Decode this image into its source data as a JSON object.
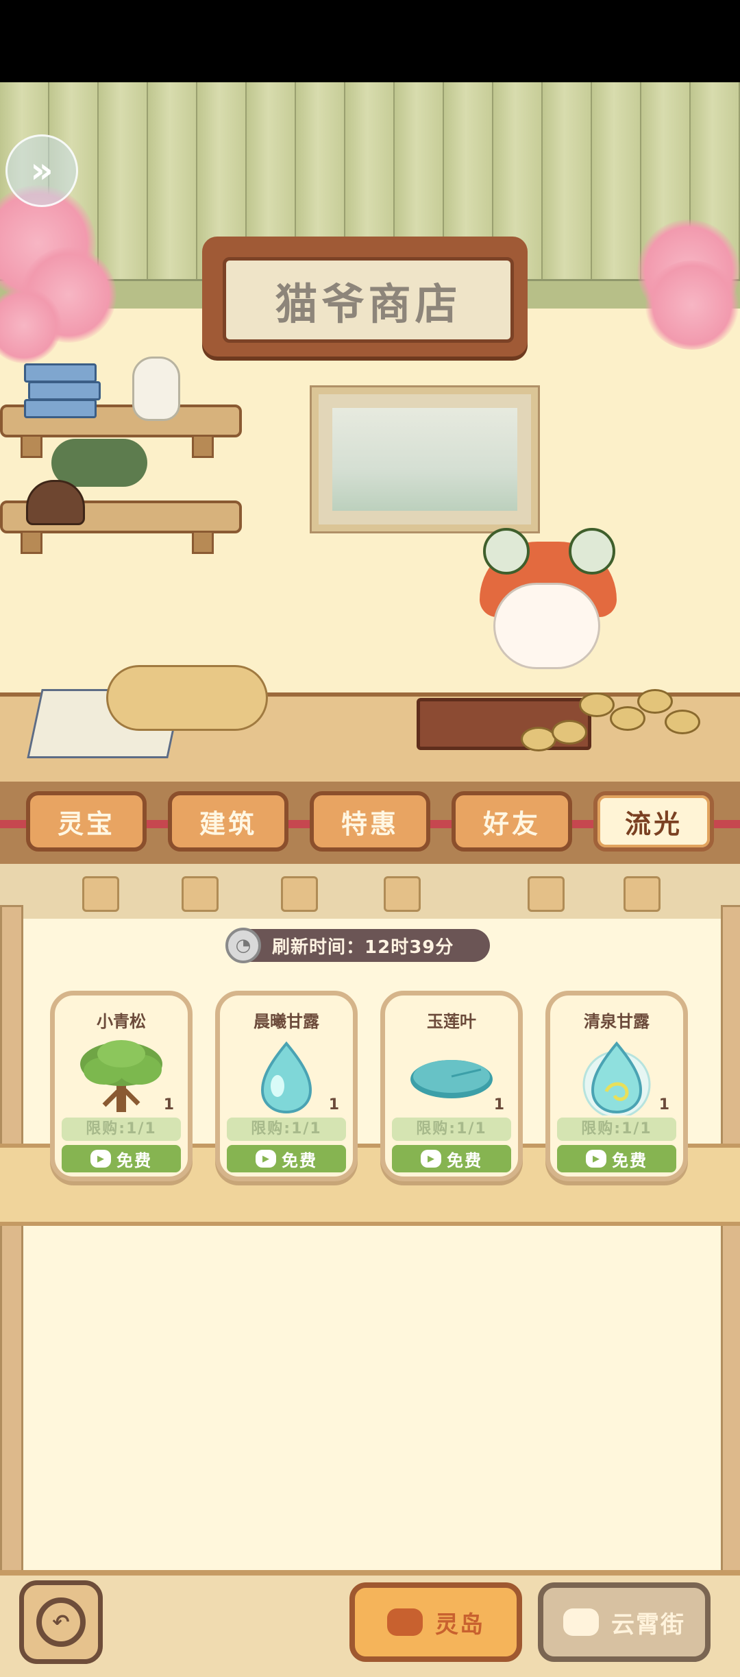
{
  "shop": {
    "title": "猫爷商店"
  },
  "tabs": [
    {
      "label": "灵宝"
    },
    {
      "label": "建筑"
    },
    {
      "label": "特惠"
    },
    {
      "label": "好友"
    },
    {
      "label": "流光",
      "active": true
    }
  ],
  "refresh": {
    "label": "刷新时间：",
    "time": "12时39分"
  },
  "items": [
    {
      "name": "小青松",
      "icon": "pine-tree-icon",
      "qty": "1",
      "limit": "限购:1/1",
      "price": "免费"
    },
    {
      "name": "晨曦甘露",
      "icon": "dew-drop-icon",
      "qty": "1",
      "limit": "限购:1/1",
      "price": "免费"
    },
    {
      "name": "玉莲叶",
      "icon": "lotus-leaf-icon",
      "qty": "1",
      "limit": "限购:1/1",
      "price": "免费"
    },
    {
      "name": "清泉甘露",
      "icon": "spring-dew-icon",
      "qty": "1",
      "limit": "限购:1/1",
      "price": "免费"
    }
  ],
  "nav": {
    "lingdao": "灵岛",
    "yunxiao": "云霄街"
  },
  "colors": {
    "accent": "#86b451",
    "brand": "#f5b45a",
    "wood": "#9f5830"
  }
}
